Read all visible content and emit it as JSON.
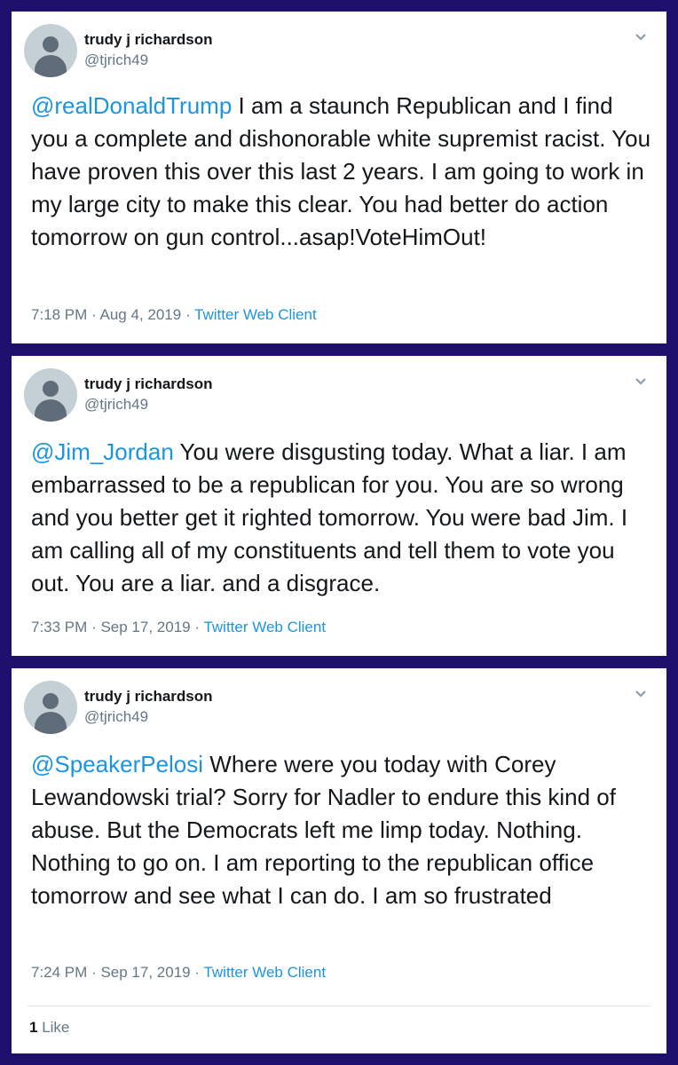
{
  "tweets": [
    {
      "author_name": "trudy j richardson",
      "author_handle": "@tjrich49",
      "mention": "@realDonaldTrump",
      "text": " I am a staunch Republican and I find you a complete and dishonorable white supremist racist. You have proven this over this last 2 years. I am going to work in my large city to make this clear. You had better do action tomorrow on gun control...asap!VoteHimOut!",
      "time": "7:18 PM",
      "date": "Aug 4, 2019",
      "client": "Twitter Web Client"
    },
    {
      "author_name": "trudy j richardson",
      "author_handle": "@tjrich49",
      "mention": "@Jim_Jordan",
      "text": " You were disgusting today.  What a liar. I am embarrassed to be a republican for you. You are so wrong and you better get it righted tomorrow. You were bad Jim. I am calling all of my constituents and tell them to vote you out. You are a liar. and a disgrace.",
      "time": "7:33 PM",
      "date": "Sep 17, 2019",
      "client": "Twitter Web Client"
    },
    {
      "author_name": "trudy j richardson",
      "author_handle": "@tjrich49",
      "mention": "@SpeakerPelosi",
      "text": " Where were you today with Corey Lewandowski trial?  Sorry for Nadler to endure this kind of abuse.  But the Democrats left me limp today. Nothing. Nothing to go on. I am reporting to the republican office tomorrow and see what I can do. I am so frustrated",
      "time": "7:24 PM",
      "date": "Sep 17, 2019",
      "client": "Twitter Web Client",
      "like_count": "1",
      "like_label": "Like"
    }
  ],
  "separator": "·",
  "icons": {
    "avatar": "default-avatar-icon",
    "menu": "chevron-down-icon"
  },
  "colors": {
    "background": "#1d0f6b",
    "link": "#1b95e0",
    "muted": "#657786",
    "text": "#14171a"
  }
}
